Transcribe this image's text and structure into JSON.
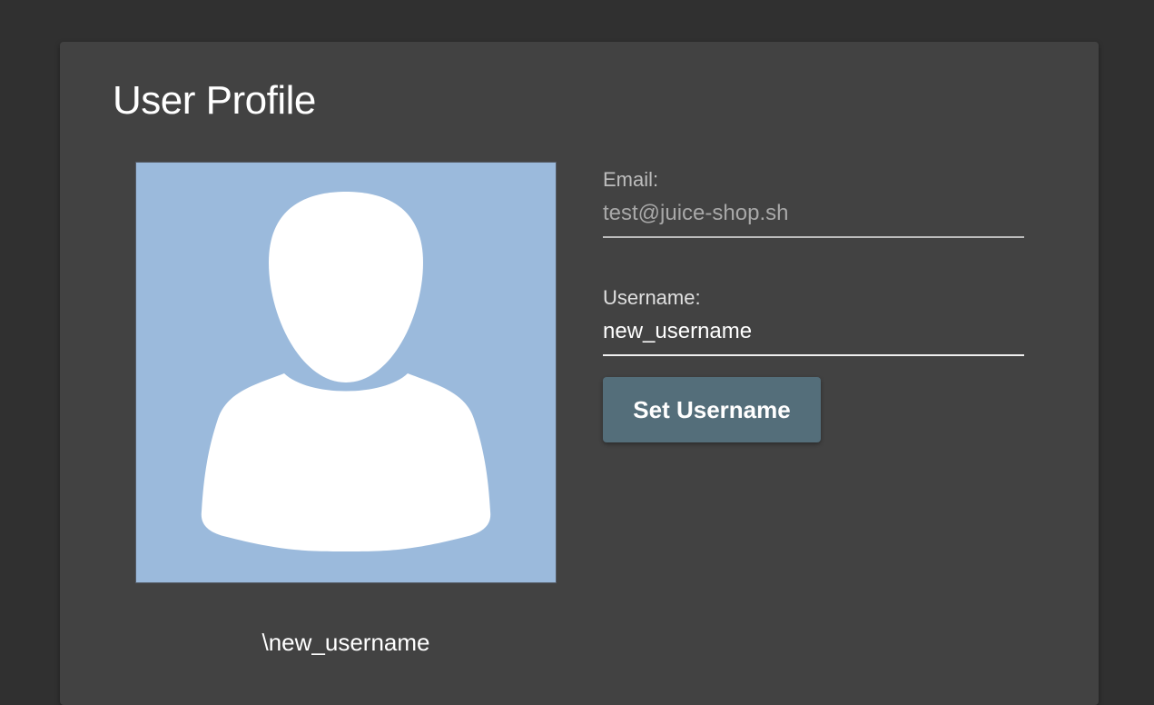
{
  "colors": {
    "page_background": "#303030",
    "card_background": "#424242",
    "avatar_background": "#9bbadc",
    "button_background": "#546e7a",
    "text_primary": "#ffffff"
  },
  "profile": {
    "title": "User Profile",
    "avatar_icon": "default-user-silhouette-icon",
    "avatar_caption": "\\new_username"
  },
  "form": {
    "email": {
      "label": "Email:",
      "value": "test@juice-shop.sh"
    },
    "username": {
      "label": "Username:",
      "value": "new_username"
    },
    "set_username_label": "Set Username"
  }
}
